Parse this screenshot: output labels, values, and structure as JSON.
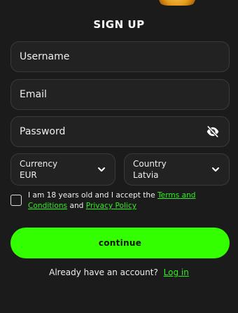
{
  "header": {
    "title": "SIGN UP"
  },
  "form": {
    "username_placeholder": "Username",
    "email_placeholder": "Email",
    "password_placeholder": "Password",
    "currency": {
      "label": "Currency",
      "value": "EUR"
    },
    "country": {
      "label": "Country",
      "value": "Latvia"
    },
    "terms": {
      "prefix": "I am 18 years old and I accept the",
      "terms_link": "Terms and Conditions",
      "middle": "and",
      "privacy_link": "Privacy Policy"
    },
    "continue_label": "continue"
  },
  "footer": {
    "question": "Already have an account?",
    "login_link": "Log in"
  },
  "colors": {
    "accent": "#33ff00",
    "link": "#2ff01f",
    "background": "#1b1b1b",
    "field_background": "#222222"
  },
  "icons": {
    "password_toggle": "eye-off-icon",
    "dropdown": "chevron-down-icon"
  }
}
